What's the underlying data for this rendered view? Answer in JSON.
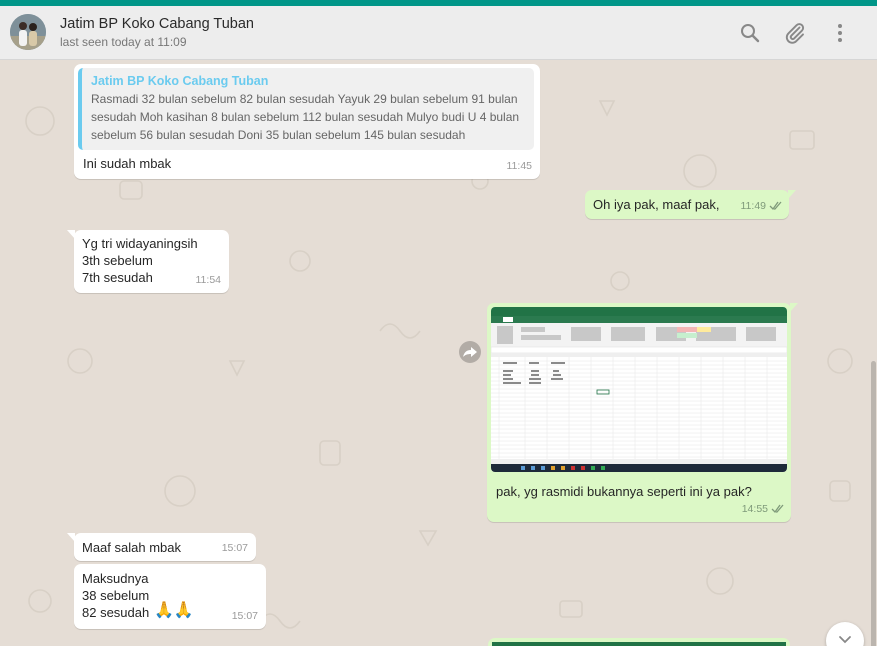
{
  "header": {
    "contact_name": "Jatim BP Koko Cabang Tuban",
    "status": "last seen today at 11:09",
    "icons": [
      "search-icon",
      "attach-icon",
      "menu-icon"
    ]
  },
  "colors": {
    "accent": "#009688",
    "incoming_bubble": "#ffffff",
    "outgoing_bubble": "#dcf8c6",
    "quote_name": "#6bcbef",
    "chat_background": "#e5ddd5"
  },
  "messages": [
    {
      "direction": "in",
      "quote_name": "Jatim BP Koko Cabang Tuban",
      "quote_lines": [
        "Rasmadi 32 bulan sebelum 82 bulan sesudah Yayuk 29 bulan sebelum 91 bulan",
        "sesudah Moh kasihan 8 bulan sebelum 112 bulan sesudah Mulyo budi U 4 bulan",
        "sebelum 56 bulan sesudah Doni 35 bulan sebelum 145 bulan sesudah"
      ],
      "text": "Ini sudah mbak",
      "time": "11:45"
    },
    {
      "direction": "out",
      "text": "Oh iya pak, maaf pak,",
      "time": "11:49"
    },
    {
      "direction": "in",
      "text": "Yg tri widayaningsih\n3th sebelum\n7th sesudah",
      "time": "11:54"
    },
    {
      "direction": "out",
      "attachment": "excel-screenshot-image",
      "text": "pak, yg rasmidi bukannya seperti ini ya pak?",
      "time": "14:55"
    },
    {
      "direction": "in",
      "text": "Maaf salah mbak",
      "time": "15:07"
    },
    {
      "direction": "in",
      "text": "Maksudnya\n38 sebelum\n82 sesudah",
      "emoji": "🙏🙏",
      "time": "15:07"
    }
  ]
}
